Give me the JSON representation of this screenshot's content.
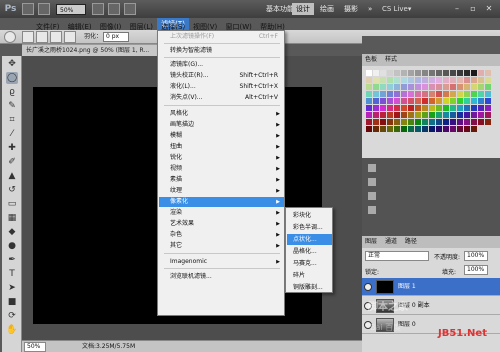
{
  "app": {
    "logo": "Ps",
    "zoom": "50%",
    "menus": [
      "文件(F)",
      "编辑(E)",
      "图像(I)",
      "图层(L)",
      "选择(S)"
    ],
    "filter_menu": "滤镜(T)",
    "right_menus": [
      "视图(V)",
      "窗口(W)",
      "帮助(H)"
    ]
  },
  "workspaces": {
    "basic": "基本功能",
    "design": "设计",
    "paint": "绘画",
    "photo": "摄影",
    "more": "»",
    "cs_live": "CS Live▾"
  },
  "options": {
    "feather_label": "羽化：",
    "feather_value": "0 px"
  },
  "document": {
    "tab_title": "长广溪之雨桥1024.png @ 50% (图层 1, R..."
  },
  "status": {
    "zoom": "50%",
    "doc_size": "文档:3.25M/5.75M"
  },
  "filter_menu": {
    "items": [
      {
        "label": "上次滤镜操作(F)",
        "shortcut": "Ctrl+F",
        "disabled": true
      },
      {
        "label": "转换为智能滤镜",
        "shortcut": ""
      },
      {
        "label": "滤镜库(G)...",
        "shortcut": ""
      },
      {
        "label": "镜头校正(R)...",
        "shortcut": "Shift+Ctrl+R"
      },
      {
        "label": "液化(L)...",
        "shortcut": "Shift+Ctrl+X"
      },
      {
        "label": "消失点(V)...",
        "shortcut": "Alt+Ctrl+V"
      },
      {
        "label": "风格化"
      },
      {
        "label": "画笔描边"
      },
      {
        "label": "模糊"
      },
      {
        "label": "扭曲"
      },
      {
        "label": "锐化"
      },
      {
        "label": "视频"
      },
      {
        "label": "素描"
      },
      {
        "label": "纹理"
      },
      {
        "label": "像素化"
      },
      {
        "label": "渲染"
      },
      {
        "label": "艺术效果"
      },
      {
        "label": "杂色"
      },
      {
        "label": "其它"
      },
      {
        "label": "Imagenomic"
      },
      {
        "label": "浏览联机滤镜..."
      }
    ]
  },
  "submenu": {
    "items": [
      "彩块化",
      "彩色半调...",
      "点状化...",
      "晶格化...",
      "马赛克...",
      "碎片",
      "铜版雕刻..."
    ]
  },
  "swatches": {
    "tabs": [
      "色板",
      "样式"
    ]
  },
  "layers": {
    "tabs": [
      "图层",
      "通道",
      "路径"
    ],
    "blend_mode": "正常",
    "opacity_label": "不透明度:",
    "opacity": "100%",
    "lock_label": "锁定:",
    "fill_label": "填充:",
    "fill": "100%",
    "rows": [
      "图层 1",
      "图层 0 副本",
      "图层 0"
    ]
  },
  "watermark": {
    "text": "脚本之家",
    "brand": "JB51.Net",
    "baidu": "Bai 百度"
  },
  "colors": {
    "highlight": "#3a8ee6",
    "layer_selected": "#3c6fc8"
  }
}
